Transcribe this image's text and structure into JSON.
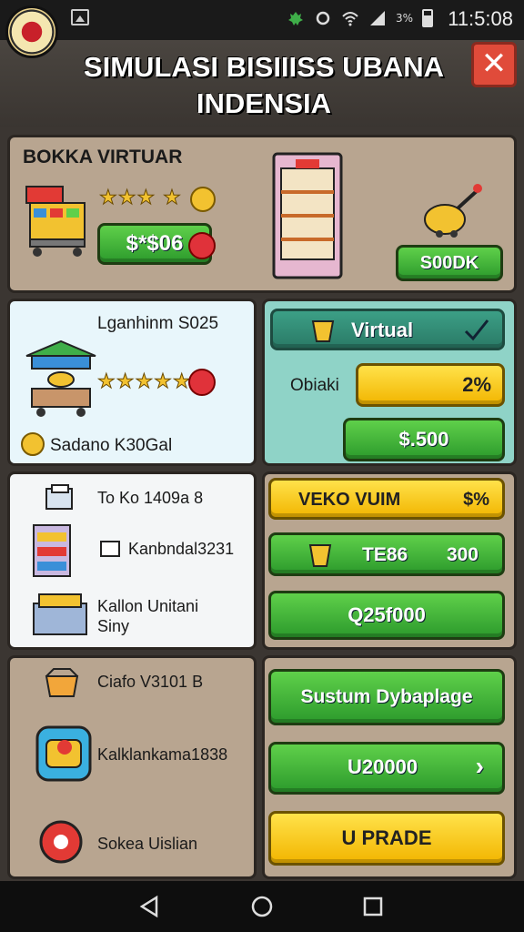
{
  "status_bar": {
    "time": "11:5:08",
    "battery_text": "3%"
  },
  "header": {
    "title": "SIMULASI BISIIISS UBANA INDENSIA",
    "close_label": "✕"
  },
  "panel1": {
    "heading": "BOKKA VIRTUAR",
    "price_button": "$*$06",
    "stock_button": "S00DK"
  },
  "panel2": {
    "title": "Lganhinm S025",
    "footer": "Sadano K30Gal"
  },
  "panel3": {
    "virtual_label": "Virtual",
    "obiaki_label": "Obiaki",
    "progress_label": "2%",
    "progress_value": 0.85,
    "price_button": "$.500"
  },
  "panel4": {
    "items": [
      "To Ko 1409a 8",
      "Kanbndal3231",
      "Kallon Unitani\nSiny"
    ]
  },
  "panel5": {
    "bar1": "VEKO VUIM",
    "bar1_value": "$%",
    "bar2_label": "TE86",
    "bar2_value": "300",
    "bar3": "Q25f000"
  },
  "panel6": {
    "items": [
      "Ciafo V3101 B",
      "Kalklankama1838",
      "Sokea Uislian"
    ]
  },
  "panel7": {
    "btn1": "Sustum Dybaplage",
    "btn2": "U20000",
    "btn2_arrow": "›",
    "btn3": "U PRADE"
  }
}
